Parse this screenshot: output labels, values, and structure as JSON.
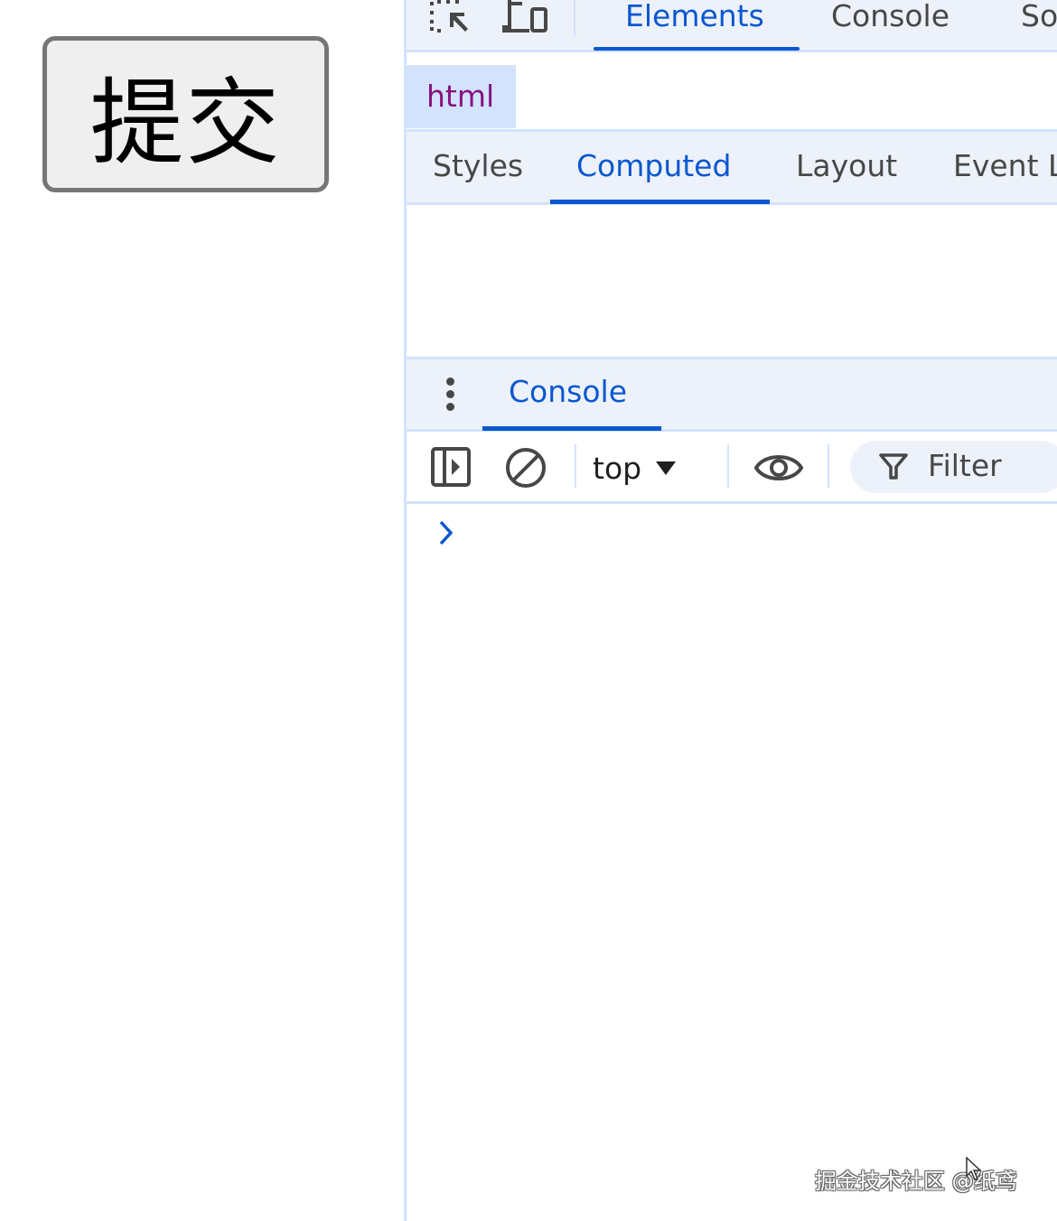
{
  "page": {
    "submit_button_label": "提交"
  },
  "devtools": {
    "top_tabs": [
      {
        "label": "Elements",
        "active": true
      },
      {
        "label": "Console",
        "active": false
      },
      {
        "label": "So",
        "active": false
      }
    ],
    "dom_node": "html",
    "sidebar_tabs": [
      {
        "label": "Styles",
        "active": false
      },
      {
        "label": "Computed",
        "active": true
      },
      {
        "label": "Layout",
        "active": false
      },
      {
        "label": "Event L",
        "active": false
      }
    ],
    "drawer": {
      "tab_label": "Console"
    },
    "console_toolbar": {
      "context_value": "top",
      "filter_placeholder": "Filter"
    },
    "colors": {
      "accent": "#0b57d0",
      "toolbar_bg": "#edf2fa",
      "border": "#d3e3fd",
      "dom_tag": "#881280",
      "text": "#474747"
    }
  },
  "watermark": {
    "text": "掘金技术社区 @纸鸢"
  },
  "icons": [
    "inspect-element-icon",
    "device-toolbar-icon",
    "kebab-menu-icon",
    "show-sidebar-icon",
    "clear-console-icon",
    "caret-down-icon",
    "live-expression-eye-icon",
    "filter-funnel-icon",
    "prompt-chevron-icon",
    "mouse-cursor-icon"
  ]
}
